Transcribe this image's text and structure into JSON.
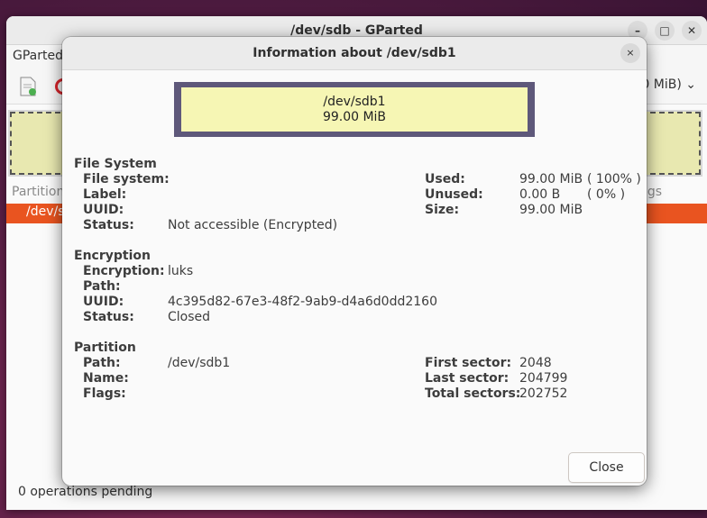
{
  "bg_window": {
    "title": "/dev/sdb - GParted",
    "menu_first": "GParted",
    "device_select": "0 MiB)",
    "col_partition": "Partition",
    "col_flags": "gs",
    "selected_row": "/dev/sd",
    "status": "0 operations pending"
  },
  "dialog": {
    "title": "Information about /dev/sdb1",
    "close_icon": "×",
    "graphic": {
      "path": "/dev/sdb1",
      "size": "99.00 MiB"
    },
    "fs_section": {
      "title": "File System",
      "labels": [
        "File system:",
        "Label:",
        "UUID:",
        "Status:"
      ],
      "status_value": "Not accessible (Encrypted)",
      "used_label": "Used:",
      "used_value": "99.00 MiB",
      "used_pct": "( 100% )",
      "unused_label": "Unused:",
      "unused_value": "0.00 B",
      "unused_pct": "( 0% )",
      "size_label": "Size:",
      "size_value": "99.00 MiB"
    },
    "enc_section": {
      "title": "Encryption",
      "encryption_label": "Encryption:",
      "encryption_value": "luks",
      "path_label": "Path:",
      "uuid_label": "UUID:",
      "uuid_value": "4c395d82-67e3-48f2-9ab9-d4a6d0dd2160",
      "status_label": "Status:",
      "status_value": "Closed"
    },
    "part_section": {
      "title": "Partition",
      "path_label": "Path:",
      "path_value": "/dev/sdb1",
      "name_label": "Name:",
      "flags_label": "Flags:",
      "first_sector_label": "First sector:",
      "first_sector_value": "2048",
      "last_sector_label": "Last sector:",
      "last_sector_value": "204799",
      "total_sectors_label": "Total sectors:",
      "total_sectors_value": "202752"
    },
    "close_button": "Close"
  },
  "colors": {
    "accent": "#e95420",
    "partition_fill": "#f6f6b4",
    "partition_border": "#5e587a"
  }
}
